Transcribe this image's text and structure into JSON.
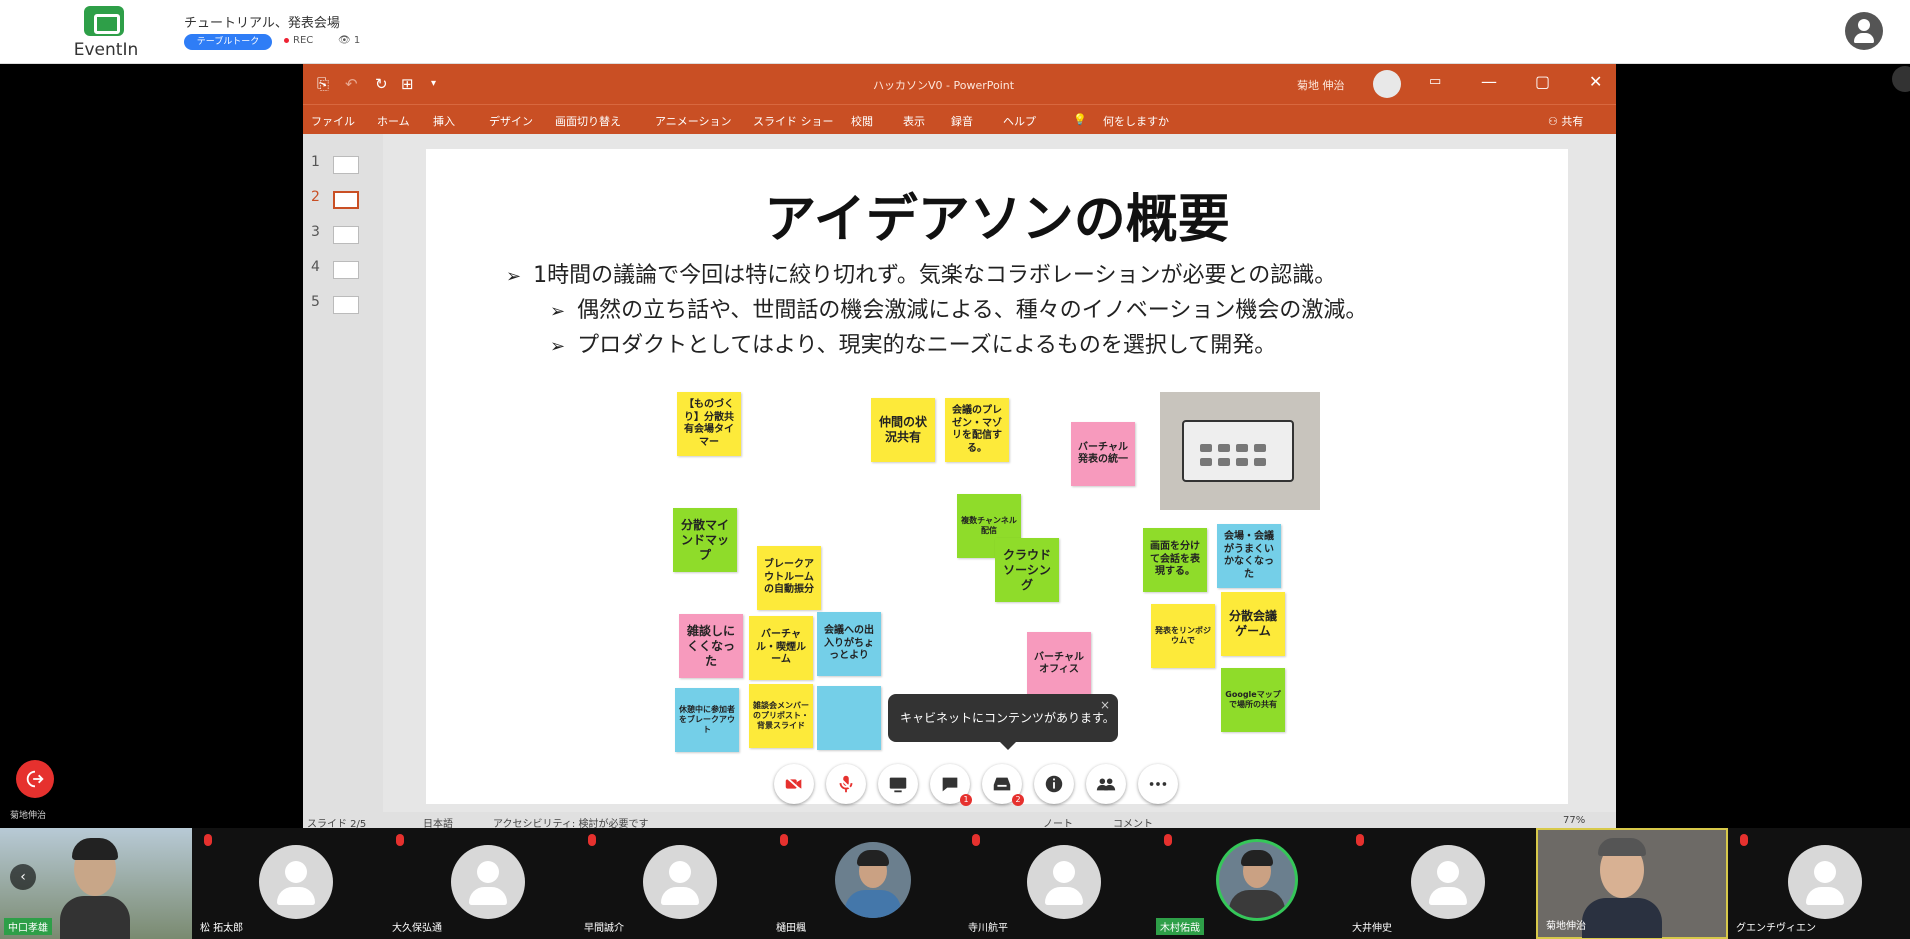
{
  "app": {
    "logo_text": "EventIn",
    "meeting_title": "チュートリアル、発表会場",
    "pill_label": "テーブルトーク",
    "rec_label": "REC",
    "viewer_count": "1"
  },
  "ppt": {
    "doc_title": "ハッカソンV0 - PowerPoint",
    "user": "菊地 伸治",
    "share": "共有",
    "menu": [
      "ファイル",
      "ホーム",
      "挿入",
      "デザイン",
      "画面切り替え",
      "アニメーション",
      "スライド ショー",
      "校閲",
      "表示",
      "録音",
      "ヘルプ",
      "何をしますか"
    ],
    "thumb_numbers": [
      "1",
      "2",
      "3",
      "4",
      "5"
    ],
    "status": {
      "slide": "スライド 2/5",
      "lang": "日本語",
      "access": "アクセシビリティ: 検討が必要です",
      "notes": "ノート",
      "comments": "コメント",
      "zoom": "77%"
    }
  },
  "slide": {
    "title": "アイデアソンの概要",
    "bullets": [
      "1時間の議論で今回は特に絞り切れず。気楽なコラボレーションが必要との認識。",
      "偶然の立ち話や、世間話の機会激減による、種々のイノベーション機会の激減。",
      "プロダクトとしてはより、現実的なニーズによるものを選択して開発。"
    ],
    "stickies": [
      "【ものづくり】分散共有会場タイマー",
      "仲間の状況共有",
      "会議のプレゼン・マゾリを配信する。",
      "バーチャル発表の統一",
      "分散マインドマップ",
      "ブレークアウトルームの自動振分",
      "複数チャンネル配信",
      "クラウドソーシング",
      "画面を分けて会話を表現する。",
      "会場・会議がうまくいかなくなった",
      "雑談しにくくなった",
      "バーチャル・喫煙ルーム",
      "会議への出入りがちょっとより",
      "分散会議ゲーム",
      "発表をリンポジウムで",
      "バーチャルオフィス",
      "休憩中に参加者をブレークアウト",
      "雑談会メンバーのプリポスト・背景スライド",
      "Googleマップで場所の共有"
    ]
  },
  "tooltip": {
    "text": "キャビネットにコンテンツがあります。",
    "close": "×"
  },
  "controls": {
    "badges": [
      "1",
      "2"
    ],
    "leave_label": "菊地伸治"
  },
  "participants": [
    {
      "name": "中口孝雄"
    },
    {
      "name": "松 拓太郎"
    },
    {
      "name": "大久保弘通"
    },
    {
      "name": "早間誠介"
    },
    {
      "name": "樋田楓"
    },
    {
      "name": "寺川航平"
    },
    {
      "name": "木村佑哉"
    },
    {
      "name": "大井伸史"
    },
    {
      "name": "菊地伸治"
    },
    {
      "name": "グエンチヴィエン"
    }
  ],
  "colors": {
    "accent_green": "#2e9f48",
    "ppt_orange": "#c94f24",
    "danger": "#e6312e",
    "sticky_yellow": "#fdea3a",
    "sticky_green": "#8fdc2a",
    "sticky_pink": "#f79abd",
    "sticky_blue": "#74cfe8"
  }
}
